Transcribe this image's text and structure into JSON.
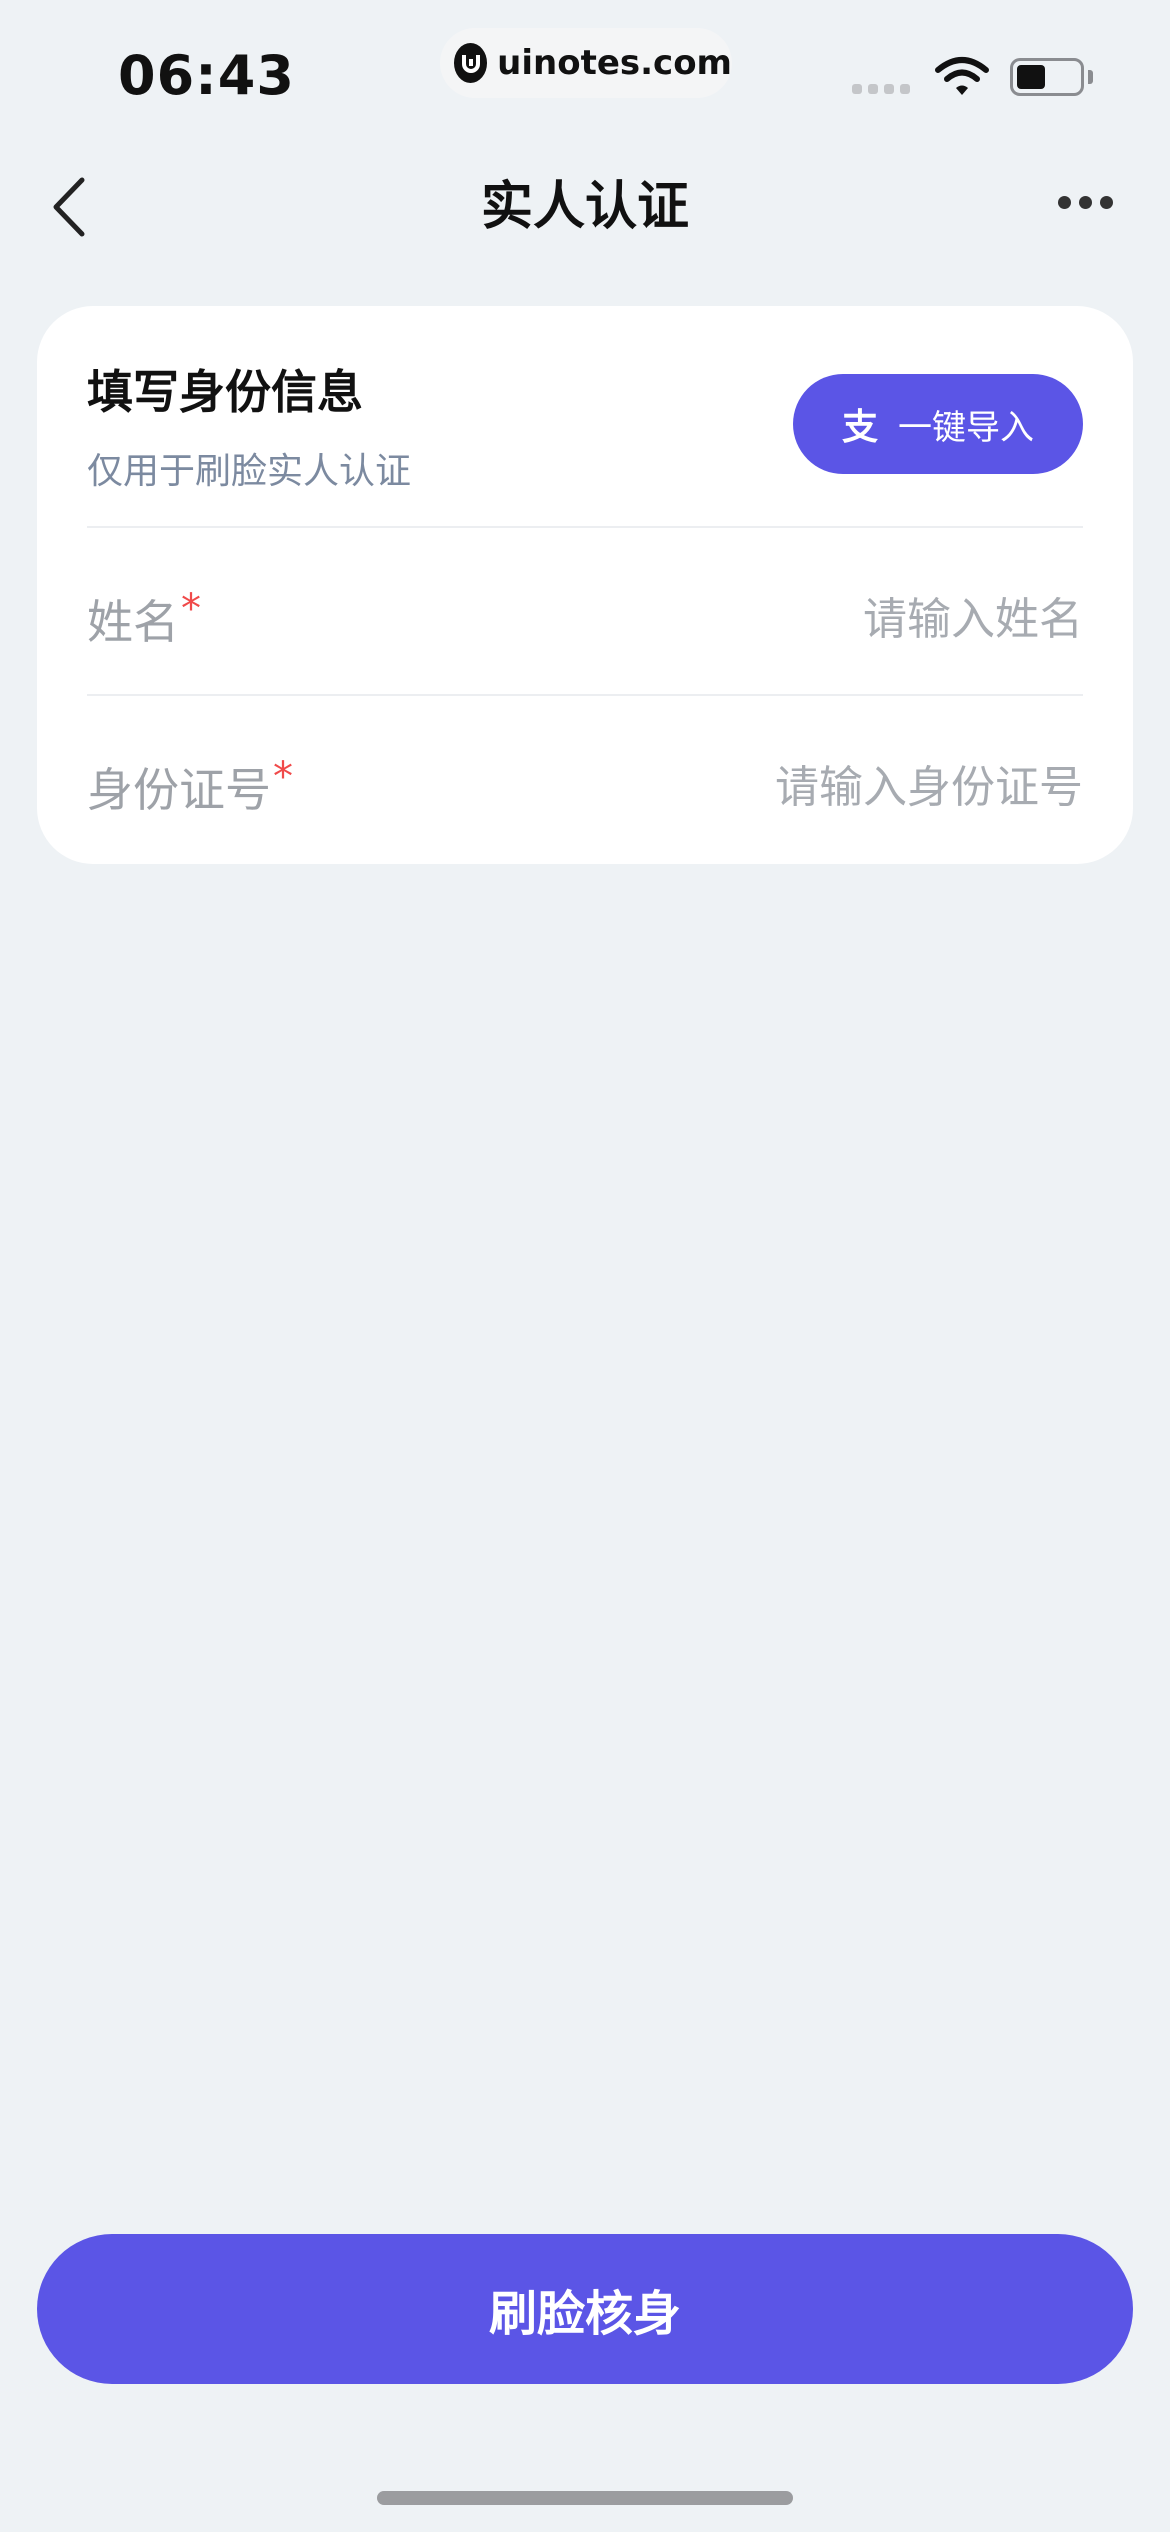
{
  "status_bar": {
    "time": "06:43",
    "watermark": "uinotes.com"
  },
  "nav": {
    "title": "实人认证"
  },
  "card": {
    "title": "填写身份信息",
    "subtitle": "仅用于刷脸实人认证",
    "import_button": {
      "icon": "alipay-icon",
      "icon_glyph": "支",
      "label": "一键导入"
    },
    "fields": [
      {
        "label": "姓名",
        "required_mark": "*",
        "placeholder": "请输入姓名",
        "value": ""
      },
      {
        "label": "身份证号",
        "required_mark": "*",
        "placeholder": "请输入身份证号",
        "value": ""
      }
    ]
  },
  "primary_button": {
    "label": "刷脸核身"
  },
  "colors": {
    "accent": "#5b55e6",
    "background": "#eef2f5",
    "required": "#f04a4a",
    "subtitle": "#7c8aa0"
  }
}
